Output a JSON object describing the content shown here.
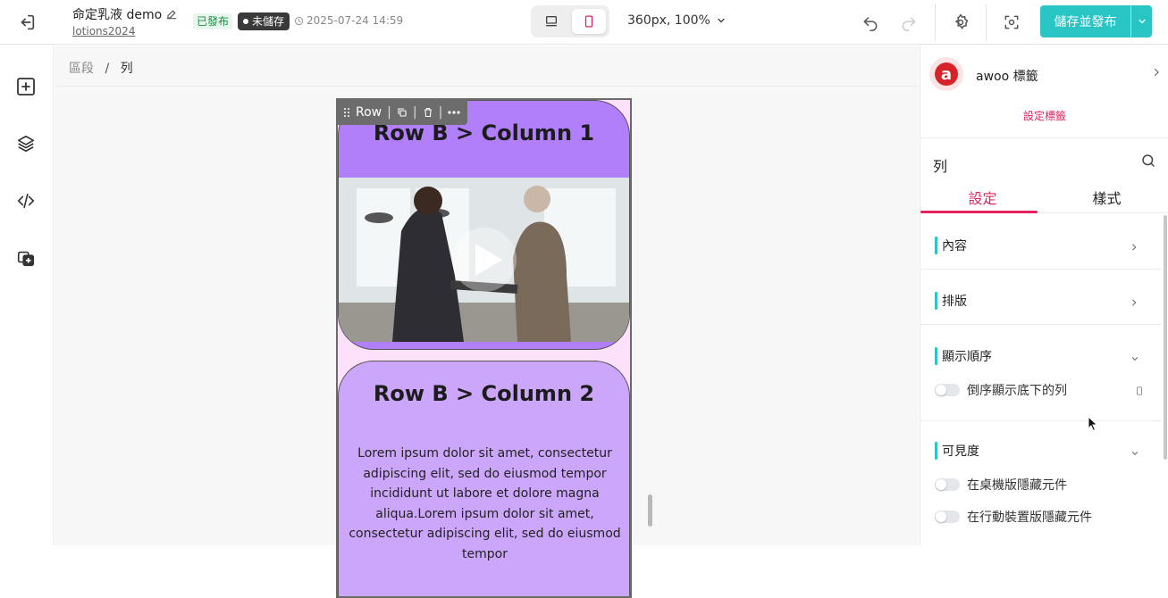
{
  "header": {
    "title": "命定乳液 demo",
    "subtitle": "lotions2024",
    "status_published": "已發布",
    "status_unsaved": "未儲存",
    "timestamp": "2025-07-24 14:59",
    "zoom_label": "360px, 100%",
    "publish_label": "儲存並發布",
    "active_device": "mobile"
  },
  "breadcrumb": {
    "items": [
      "區段",
      "列"
    ]
  },
  "canvas": {
    "row_toolbar_label": "Row",
    "column1_title": "Row B > Column 1",
    "column2_title": "Row B > Column 2",
    "column2_text": "Lorem ipsum dolor sit amet, consectetur adipiscing elit, sed do eiusmod tempor incididunt ut labore et dolore magna aliqua.Lorem ipsum dolor sit amet, consectetur adipiscing elit, sed do eiusmod tempor",
    "column1_color": "#b27ffa",
    "column2_color": "#cca6fa",
    "background_color": "#fde0fa"
  },
  "panel": {
    "app_name": "awoo 標籤",
    "app_link": "設定標籤",
    "title": "列",
    "tabs": [
      {
        "label": "設定",
        "active": true
      },
      {
        "label": "樣式",
        "active": false
      }
    ],
    "sections": {
      "content": "內容",
      "layout": "排版",
      "order": "顯示順序",
      "order_toggle": "倒序顯示底下的列",
      "visibility": "可見度",
      "hide_desktop": "在桌機版隱藏元件",
      "hide_mobile": "在行動裝置版隱藏元件"
    },
    "accent_color": "#e0245e",
    "section_accent_color": "#2ec4c4"
  }
}
